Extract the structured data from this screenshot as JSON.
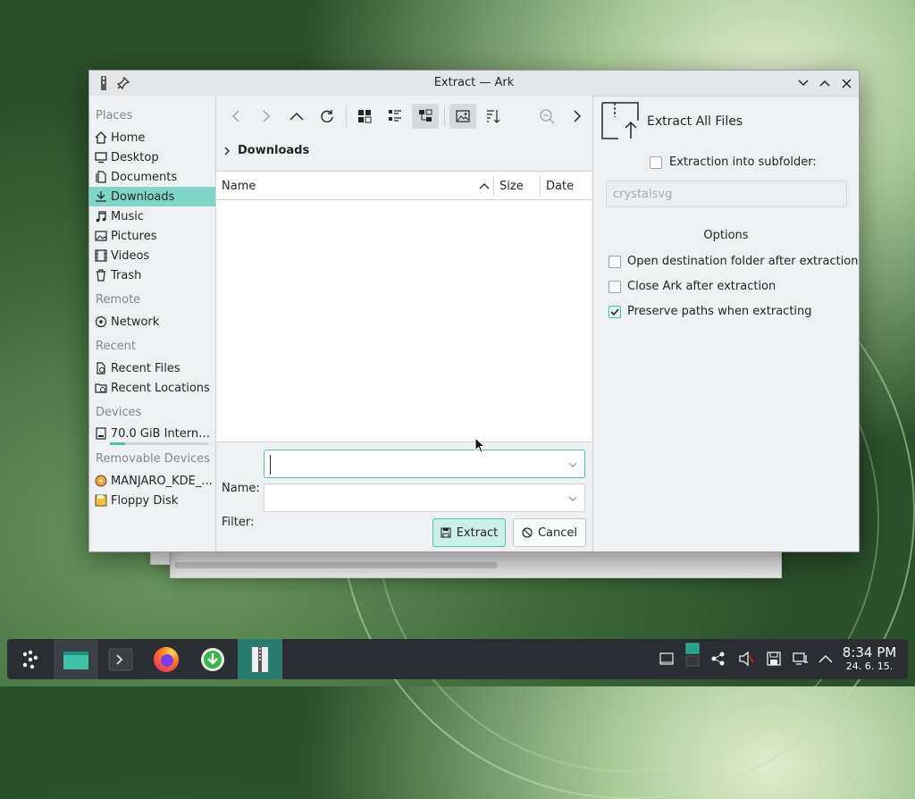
{
  "window": {
    "title": "Extract — Ark"
  },
  "places": {
    "sections": [
      "Places",
      "Remote",
      "Recent",
      "Devices",
      "Removable Devices"
    ],
    "items": [
      {
        "label": "Home",
        "icon": "home-icon"
      },
      {
        "label": "Desktop",
        "icon": "desktop-icon"
      },
      {
        "label": "Documents",
        "icon": "documents-icon"
      },
      {
        "label": "Downloads",
        "icon": "downloads-icon",
        "selected": true
      },
      {
        "label": "Music",
        "icon": "music-icon"
      },
      {
        "label": "Pictures",
        "icon": "pictures-icon"
      },
      {
        "label": "Videos",
        "icon": "videos-icon"
      },
      {
        "label": "Trash",
        "icon": "trash-icon"
      },
      {
        "label": "Network",
        "icon": "network-icon"
      },
      {
        "label": "Recent Files",
        "icon": "recent-files-icon"
      },
      {
        "label": "Recent Locations",
        "icon": "recent-locations-icon"
      },
      {
        "label": "70.0 GiB Interna...",
        "icon": "drive-icon"
      },
      {
        "label": "MANJARO_KDE_...",
        "icon": "optical-disc-icon"
      },
      {
        "label": "Floppy Disk",
        "icon": "floppy-icon"
      }
    ]
  },
  "breadcrumb": {
    "current": "Downloads"
  },
  "columns": {
    "name": "Name",
    "size": "Size",
    "date": "Date"
  },
  "form": {
    "name_label": "Name:",
    "name_value": "",
    "filter_label": "Filter:",
    "filter_value": ""
  },
  "buttons": {
    "extract": "Extract",
    "cancel": "Cancel"
  },
  "right_panel": {
    "heading": "Extract All Files",
    "subfolder_label": "Extraction into subfolder:",
    "subfolder_checked": false,
    "subfolder_value": "crystalsvg",
    "options_title": "Options",
    "options": [
      {
        "label": "Open destination folder after extraction",
        "checked": false
      },
      {
        "label": "Close Ark after extraction",
        "checked": false
      },
      {
        "label": "Preserve paths when extracting",
        "checked": true
      }
    ]
  },
  "taskbar": {
    "time": "8:34 PM",
    "date": "24. 6. 15."
  },
  "colors": {
    "accent": "#4fbfa9",
    "selection": "#7fd6c8",
    "panel": "#2a2e32"
  }
}
